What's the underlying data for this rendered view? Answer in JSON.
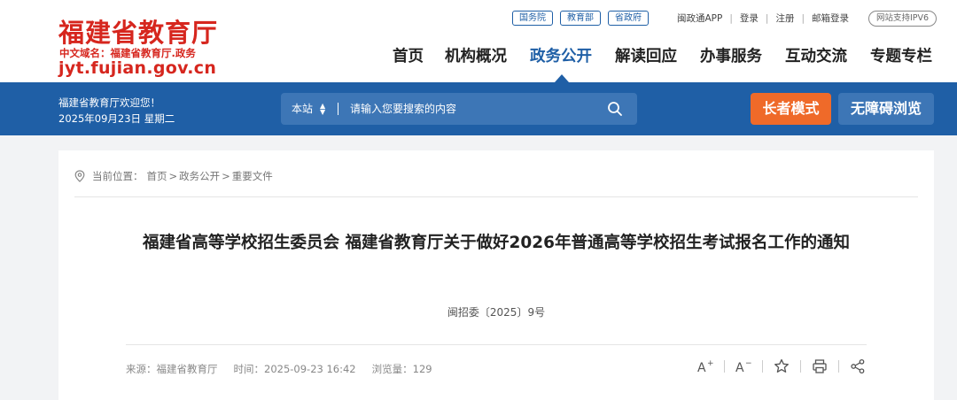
{
  "header": {
    "logo_title": "福建省教育厅",
    "logo_sub": "中文域名：福建省教育厅.政务",
    "logo_domain": "jyt.fujian.gov.cn",
    "gov_links": [
      "国务院",
      "教育部",
      "省政府"
    ],
    "user_links": [
      "闽政通APP",
      "登录",
      "注册",
      "邮箱登录"
    ],
    "ipv6": "网站支持IPV6",
    "nav": [
      "首页",
      "机构概况",
      "政务公开",
      "解读回应",
      "办事服务",
      "互动交流",
      "专题专栏"
    ],
    "nav_active": "政务公开"
  },
  "bluebar": {
    "welcome": "福建省教育厅欢迎您！",
    "date": "2025年09月23日 星期二",
    "search_scope": "本站",
    "search_placeholder": "请输入您要搜索的内容",
    "elder_mode": "长者模式",
    "accessible": "无障碍浏览"
  },
  "article": {
    "breadcrumb_prefix": "当前位置：",
    "breadcrumb": [
      "首页",
      "政务公开",
      "重要文件"
    ],
    "title": "福建省高等学校招生委员会 福建省教育厅关于做好2026年普通高等学校招生考试报名工作的通知",
    "doc_number": "闽招委〔2025〕9号",
    "source": "来源：福建省教育厅",
    "time": "时间：2025-09-23 16:42",
    "views": "浏览量：129"
  },
  "colors": {
    "brand_red": "#d6261e",
    "brand_blue": "#1f5fa6",
    "elder_orange": "#ef6a29"
  }
}
